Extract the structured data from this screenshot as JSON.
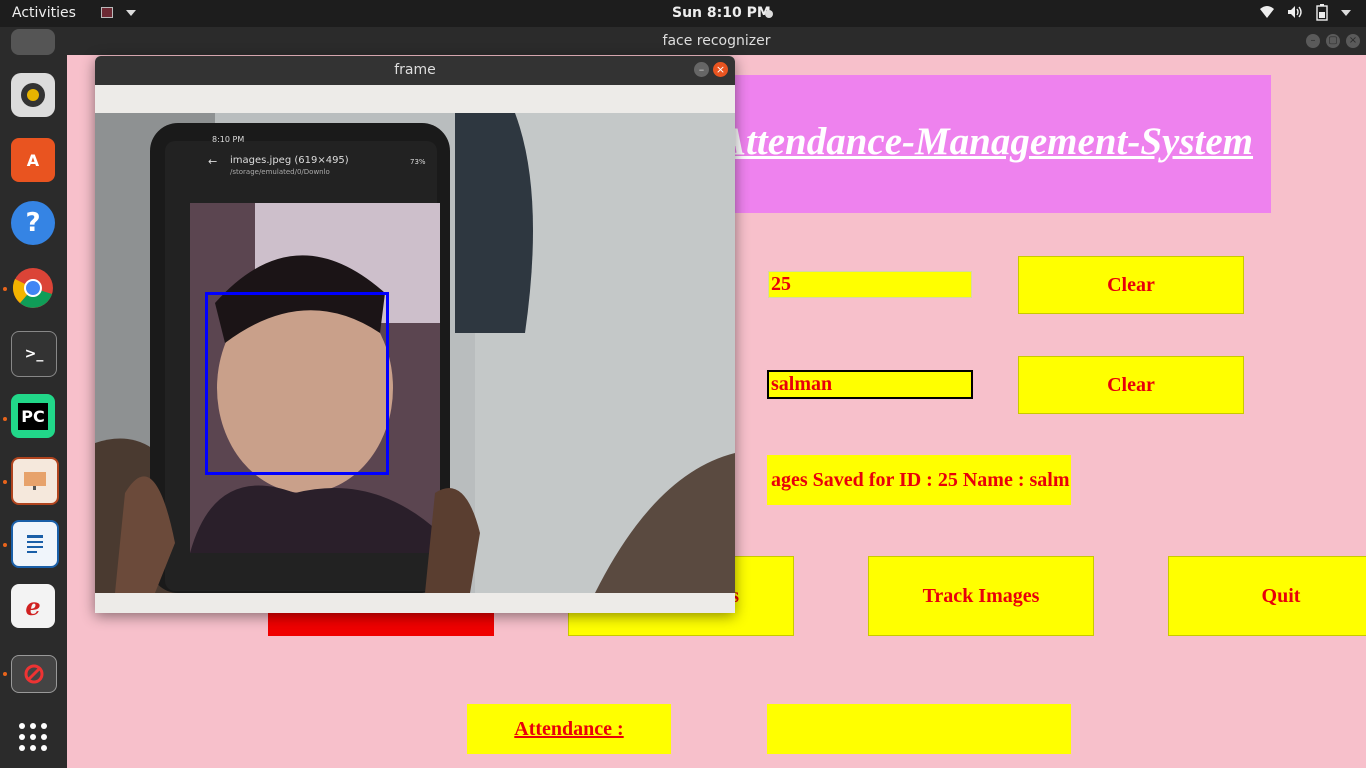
{
  "topbar": {
    "activities": "Activities",
    "clock": "Sun  8:10 PM",
    "wifi_icon": "wifi-icon",
    "volume_icon": "volume-icon",
    "battery_icon": "battery-icon"
  },
  "main_window": {
    "title": "face recognizer",
    "heading": "Attendance-Management-System",
    "id_value": "25",
    "name_value": "salman",
    "clear1_label": "Clear",
    "clear2_label": "Clear",
    "notification": "ages Saved for ID : 25 Name : salm",
    "take_images_label": "s",
    "track_images_label": "Track Images",
    "quit_label": "Quit",
    "attendance_label": "Attendance :",
    "attendance_value": ""
  },
  "frame_window": {
    "title": "frame"
  },
  "camera": {
    "phone_status_time": "8:10 PM",
    "phone_file_name": "images.jpeg (619×495)",
    "phone_file_path": "/storage/emulated/0/Downlo",
    "phone_battery": "73%"
  },
  "colors": {
    "background": "#f7c0cb",
    "banner": "#ee82ee",
    "button": "#ffff00",
    "text": "#e8000a",
    "face_box": "#0000ff"
  }
}
